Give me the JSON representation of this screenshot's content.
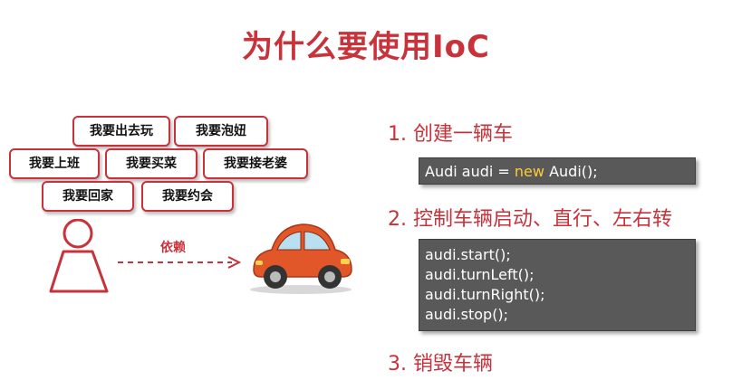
{
  "title": "为什么要使用IoC",
  "bubbles": [
    "我要出去玩",
    "我要泡妞",
    "我要上班",
    "我要买菜",
    "我要接老婆",
    "我要回家",
    "我要约会"
  ],
  "arrow_label": "依赖",
  "steps": [
    "1. 创建一辆车",
    "2. 控制车辆启动、直行、左右转",
    "3. 销毁车辆"
  ],
  "code1": {
    "pre": "Audi audi = ",
    "kw": "new",
    "post": " Audi();"
  },
  "code2": [
    "audi.start();",
    "audi.turnLeft();",
    "audi.turnRight();",
    "audi.stop();"
  ],
  "colors": {
    "accent": "#c8323a",
    "code_bg": "#595959",
    "keyword": "#ffcc33",
    "car": "#e2572a"
  }
}
